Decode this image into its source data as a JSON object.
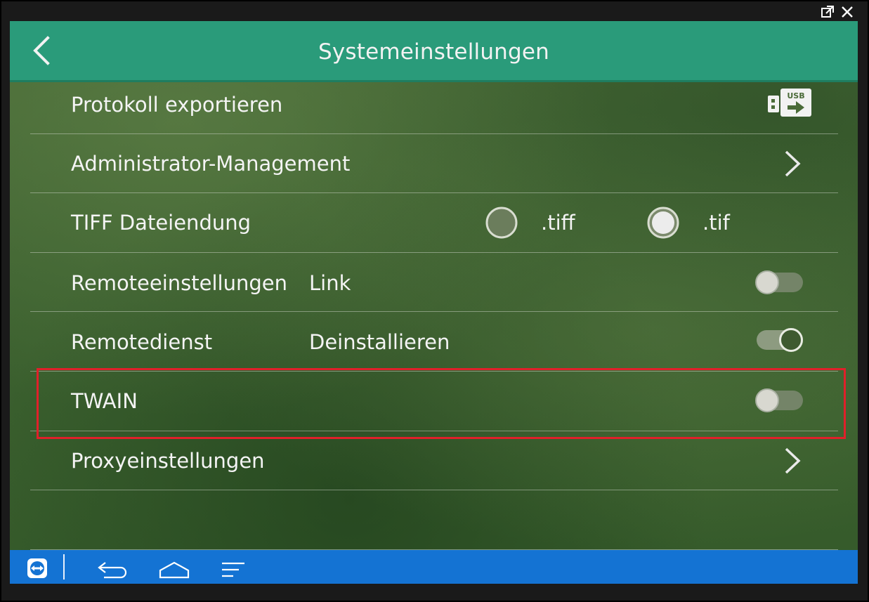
{
  "header": {
    "title": "Systemeinstellungen",
    "back_icon": "chevron-left-icon"
  },
  "rows": [
    {
      "label": "Protokoll exportieren",
      "control": "usb-export-icon",
      "usb_text": "USB"
    },
    {
      "label": "Administrator-Management",
      "control": "chevron-right-icon"
    },
    {
      "label": "TIFF Dateiendung",
      "options": [
        {
          "label": ".tiff",
          "selected": false
        },
        {
          "label": ".tif",
          "selected": true
        }
      ]
    },
    {
      "label": "Remoteeinstellungen",
      "sub": "Link",
      "toggle": false
    },
    {
      "label": "Remotedienst",
      "sub": "Deinstallieren",
      "toggle": true
    },
    {
      "label": "TWAIN",
      "toggle": false
    },
    {
      "label": "Proxyeinstellungen",
      "control": "chevron-right-icon"
    }
  ],
  "navbar": {
    "icons": [
      "teamviewer-icon",
      "back-icon",
      "home-icon",
      "menu-icon"
    ]
  },
  "colors": {
    "header": "#2a9b7a",
    "navbar": "#1473d3",
    "highlight": "#e0202a"
  }
}
